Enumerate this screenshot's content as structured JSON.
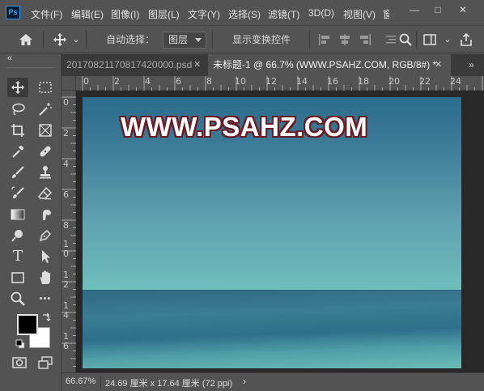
{
  "app": {
    "logo_text": "Ps",
    "accent": "#31a8ff"
  },
  "menu": [
    "文件(F)",
    "编辑(E)",
    "图像(I)",
    "图层(L)",
    "文字(Y)",
    "选择(S)",
    "滤镜(T)",
    "3D(D)",
    "视图(V)",
    "窗"
  ],
  "window_controls": {
    "minimize": "—",
    "maximize": "□",
    "close": "✕"
  },
  "options_bar": {
    "auto_select_label": "自动选择：",
    "auto_select_checked": true,
    "auto_select_target": "图层",
    "show_transform_label": "显示变换控件",
    "show_transform_checked": false,
    "chevron": "⌄"
  },
  "panel_collapse": "«",
  "tabs": [
    {
      "label": "20170821170817420000.psd",
      "close": "✕",
      "active": false
    },
    {
      "label": "未标题-1 @ 66.7% (WWW.PSAHZ.COM, RGB/8#) *",
      "close": "✕",
      "active": true
    }
  ],
  "tabs_overflow": "»",
  "ruler_h_labels": [
    "0",
    "2",
    "4",
    "6",
    "8",
    "10",
    "12",
    "14",
    "16",
    "18",
    "20",
    "22",
    "24"
  ],
  "ruler_v_labels": [
    "0",
    "2",
    "4",
    "6",
    "8",
    "1\n0",
    "1\n2",
    "1\n4",
    "1\n6"
  ],
  "canvas": {
    "watermark_text": "WWW.PSAHZ.COM",
    "sky_top": "#2c6c8c",
    "sky_bottom": "#6ebfbc",
    "sea_color": "#3b7d93"
  },
  "tools": [
    "move-tool",
    "artboard-marquee-tool",
    "lasso-tool",
    "quick-selection-tool",
    "crop-tool",
    "frame-tool",
    "eyedropper-tool",
    "healing-brush-tool",
    "brush-tool",
    "clone-stamp-tool",
    "history-brush-tool",
    "eraser-tool",
    "gradient-tool",
    "smudge-tool",
    "dodge-tool",
    "pen-tool",
    "type-tool",
    "path-selection-tool",
    "rectangle-tool",
    "hand-tool",
    "zoom-tool",
    "more-tools"
  ],
  "tool_glyphs": {
    "type": "T",
    "more": "•••"
  },
  "colors": {
    "foreground": "#000000",
    "background": "#ffffff"
  },
  "status": {
    "zoom": "66.67%",
    "doc_size": "24.69 厘米 x 17.64 厘米 (72 ppi)",
    "arrow": "›"
  }
}
